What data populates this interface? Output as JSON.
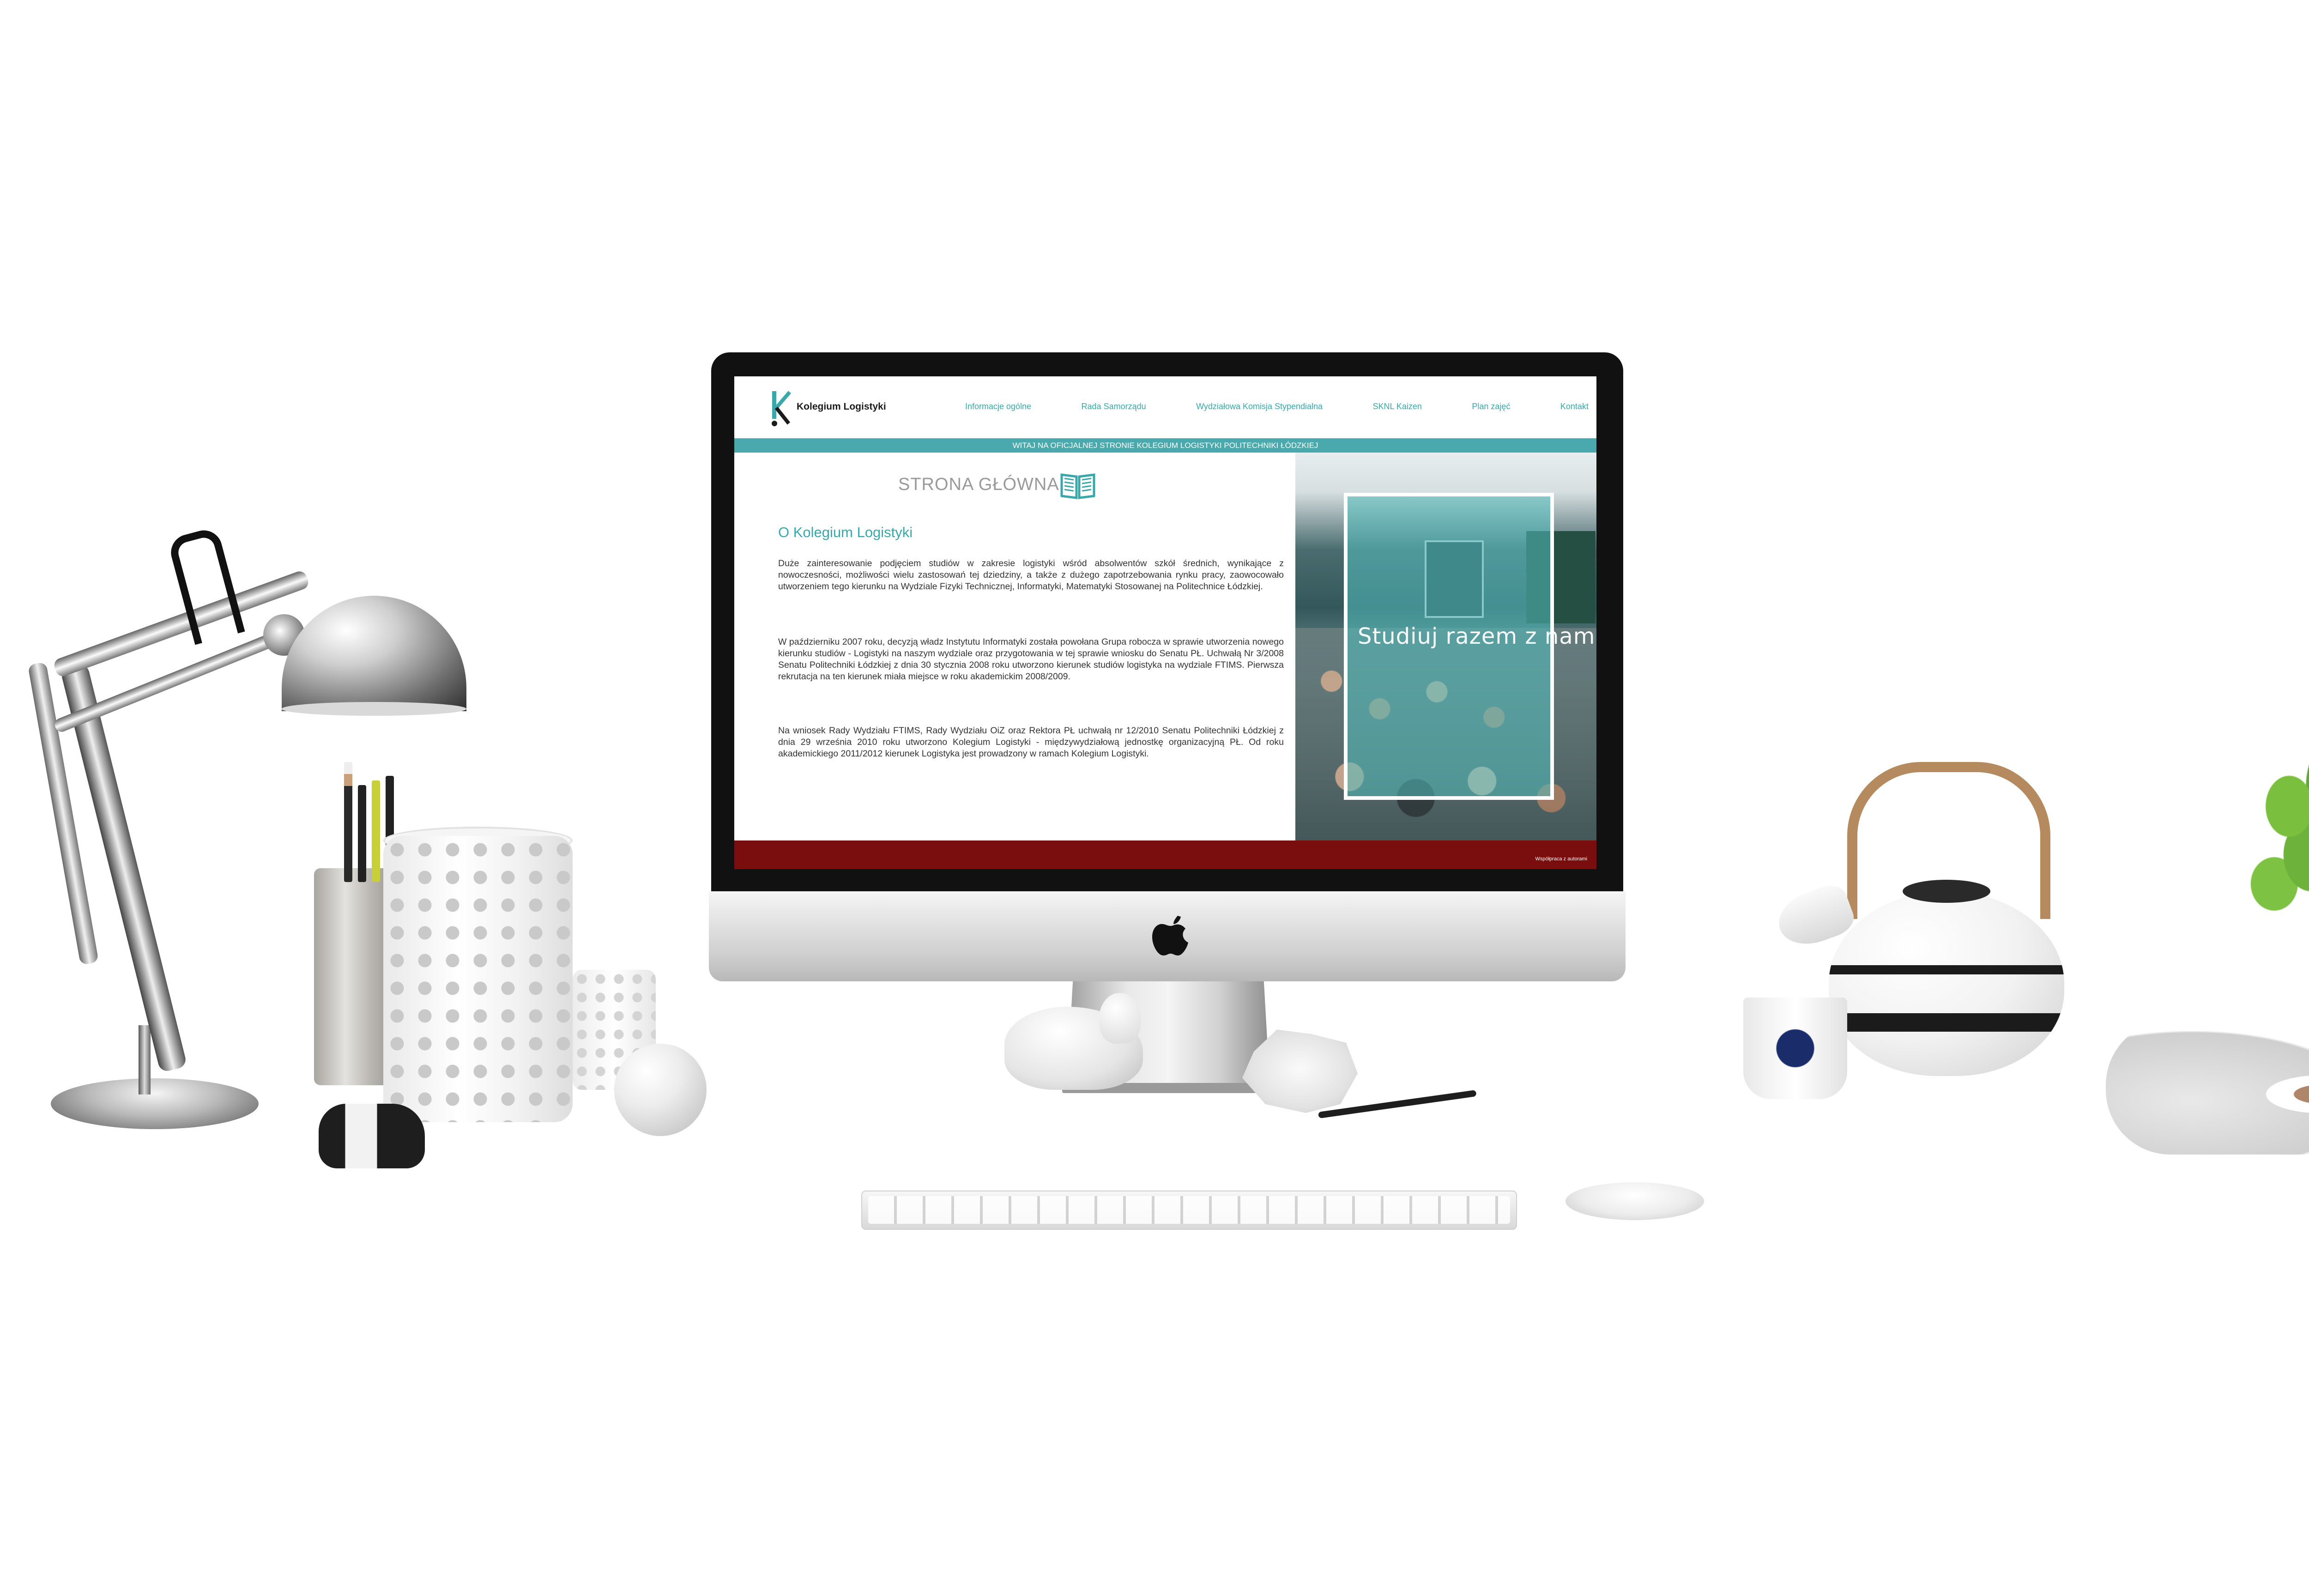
{
  "site": {
    "logo_text": "Kolegium Logistyki",
    "nav": [
      {
        "label": "Informacje ogólne"
      },
      {
        "label": "Rada Samorządu"
      },
      {
        "label": "Wydziałowa Komisja Stypendialna"
      },
      {
        "label": "SKNL Kaizen"
      },
      {
        "label": "Plan zajęć"
      },
      {
        "label": "Kontakt"
      }
    ],
    "welcome": "WITAJ NA OFICJALNEJ STRONIE KOLEGIUM LOGISTYKI POLITECHNIKI ŁÓDZKIEJ",
    "page_heading": "STRONA GŁÓWNA",
    "section_title": "O Kolegium Logistyki",
    "paragraphs": [
      "Duże zainteresowanie podjęciem studiów w zakresie logistyki wśród absolwentów szkół średnich, wynikające z nowoczesności, możliwości wielu zastosowań tej dziedziny, a także z dużego zapotrzebowania rynku pracy, zaowocowało utworzeniem tego kierunku na Wydziale Fizyki Technicznej, Informatyki, Matematyki Stosowanej na Politechnice Łódzkiej.",
      "W październiku 2007 roku, decyzją władz Instytutu Informatyki została powołana Grupa robocza w sprawie utworzenia nowego kierunku studiów - Logistyki na naszym wydziale oraz przygotowania w tej sprawie wniosku do Senatu PŁ. Uchwałą Nr 3/2008 Senatu Politechniki Łódzkiej z dnia 30 stycznia 2008 roku utworzono kierunek studiów logistyka na wydziale FTIMS. Pierwsza rekrutacja na ten kierunek miała miejsce w roku akademickim 2008/2009.",
      "Na wniosek Rady Wydziału FTIMS, Rady Wydziału OiZ oraz Rektora PŁ uchwałą nr 12/2010 Senatu Politechniki Łódzkiej z dnia 29 września 2010 roku utworzono Kolegium Logistyki - międzywydziałową jednostkę organizacyjną PŁ. Od roku akademickiego 2011/2012 kierunek Logistyka jest prowadzony w ramach Kolegium Logistyki."
    ],
    "photo_caption": "Studiuj razem z nami",
    "footer_text": "Współpraca z autorami"
  },
  "colors": {
    "accent": "#3aa8ab",
    "welcome_bar": "#4aa9ad",
    "footer": "#7a0e0e",
    "heading_gray": "#9a9a9a"
  },
  "icons": {
    "page_heading_icon": "open-book-icon",
    "device_logo": "apple-logo-icon"
  }
}
